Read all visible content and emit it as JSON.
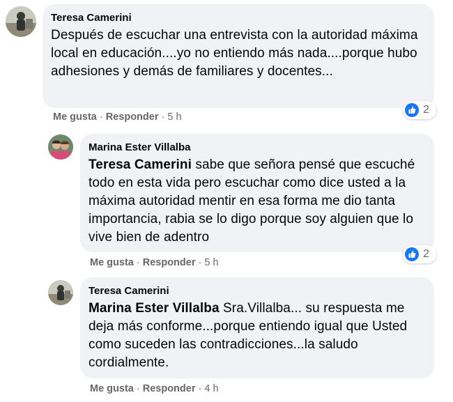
{
  "comments": [
    {
      "author": "Teresa Camerini",
      "mention": "",
      "text": "Después de escuchar una entrevista con la autoridad máxima local en educación....yo no entiendo más nada....porque hubo adhesiones y demás de familiares y docentes...",
      "like_label": "Me gusta",
      "reply_label": "Responder",
      "time": "5 h",
      "reactions": "2",
      "reaction_icon": "like-icon",
      "avatar_icon": "person-outdoor-photo-icon"
    },
    {
      "author": "Marina Ester Villalba",
      "mention": "Teresa Camerini",
      "text": "sabe que señora pensé que escuché todo en esta vida pero escuchar como dice usted a la máxima autoridad mentir en esa forma me dio tanta importancia, rabia se lo digo porque soy alguien que lo vive bien de adentro",
      "like_label": "Me gusta",
      "reply_label": "Responder",
      "time": "5 h",
      "reactions": "2",
      "reaction_icon": "like-icon",
      "avatar_icon": "two-people-photo-icon"
    },
    {
      "author": "Teresa Camerini",
      "mention": "Marina Ester Villalba",
      "text": "Sra.Villalba... su respuesta me deja más conforme...porque entiendo igual que Usted como suceden las contradicciones...la saludo cordialmente.",
      "like_label": "Me gusta",
      "reply_label": "Responder",
      "time": "4 h",
      "avatar_icon": "person-outdoor-photo-icon"
    }
  ],
  "colors": {
    "bubble": "#f0f2f5",
    "meta_text": "#65676b",
    "like_blue": "#1877f2",
    "text": "#050505"
  }
}
